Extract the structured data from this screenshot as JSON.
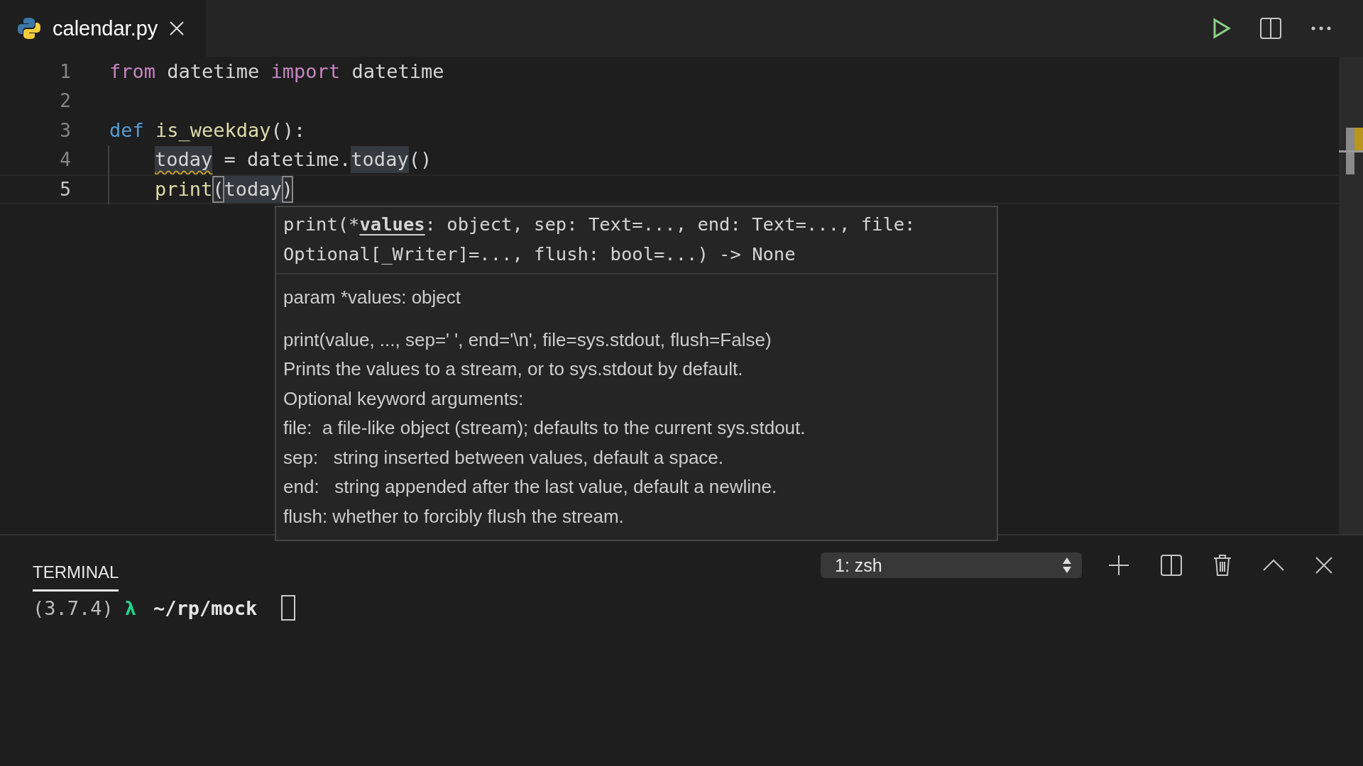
{
  "tab": {
    "label": "calendar.py",
    "selected": true
  },
  "editor": {
    "lines": [
      {
        "number": "1",
        "current": false,
        "indented": false,
        "tokens": [
          {
            "text": "from",
            "kind": "keyword",
            "highlighted": false,
            "squiggle": false,
            "boxed": false
          },
          {
            "text": " datetime ",
            "kind": "plain",
            "highlighted": false,
            "squiggle": false,
            "boxed": false
          },
          {
            "text": "import",
            "kind": "keyword",
            "highlighted": false,
            "squiggle": false,
            "boxed": false
          },
          {
            "text": " datetime",
            "kind": "plain",
            "highlighted": false,
            "squiggle": false,
            "boxed": false
          }
        ]
      },
      {
        "number": "2",
        "current": false
      },
      {
        "number": "3",
        "current": false,
        "indented": false,
        "tokens": [
          {
            "text": "def",
            "kind": "storage",
            "highlighted": false,
            "squiggle": false,
            "boxed": false
          },
          {
            "text": " is_weekday",
            "kind": "function",
            "highlighted": false,
            "squiggle": false,
            "boxed": false
          },
          {
            "text": "():",
            "kind": "plain",
            "highlighted": false,
            "squiggle": false,
            "boxed": false
          }
        ]
      },
      {
        "number": "4",
        "current": false,
        "indented": true,
        "tokens": [
          {
            "text": "today",
            "kind": "plain",
            "highlighted": true,
            "squiggle": true,
            "boxed": false
          },
          {
            "text": " = datetime.",
            "kind": "plain",
            "highlighted": false,
            "squiggle": false,
            "boxed": false
          },
          {
            "text": "today",
            "kind": "plain",
            "highlighted": true,
            "squiggle": false,
            "boxed": false
          },
          {
            "text": "()",
            "kind": "plain",
            "highlighted": false,
            "squiggle": false,
            "boxed": false
          }
        ]
      },
      {
        "number": "5",
        "current": true,
        "indented": true,
        "tokens": [
          {
            "text": "print",
            "kind": "function",
            "highlighted": false,
            "squiggle": false,
            "boxed": false
          },
          {
            "text": "(",
            "kind": "plain",
            "highlighted": false,
            "squiggle": false,
            "boxed": true
          },
          {
            "text": "today",
            "kind": "plain",
            "highlighted": true,
            "squiggle": false,
            "boxed": false
          },
          {
            "text": ")",
            "kind": "plain",
            "highlighted": false,
            "squiggle": false,
            "boxed": true
          }
        ]
      }
    ]
  },
  "hover": {
    "signature": {
      "before": "print(*",
      "active_param": "values",
      "after": ": object, sep: Text=..., end: Text=..., file: Optional[_Writer]=..., flush: bool=...) -> None"
    },
    "doc": [
      "param *values: object",
      "print(value, ..., sep=' ', end='\\n', file=sys.stdout, flush=False)",
      "Prints the values to a stream, or to sys.stdout by default.",
      "Optional keyword arguments:",
      "file:  a file-like object (stream); defaults to the current sys.stdout.",
      "sep:   string inserted between values, default a space.",
      "end:   string appended after the last value, default a newline.",
      "flush: whether to forcibly flush the stream."
    ]
  },
  "terminal": {
    "tabs": [
      {
        "label": "TERMINAL",
        "selected": true
      }
    ],
    "shell_select": "1: zsh",
    "prompt": {
      "version": "(3.7.4)",
      "symbol": "λ",
      "path": "~/rp/mock"
    }
  }
}
